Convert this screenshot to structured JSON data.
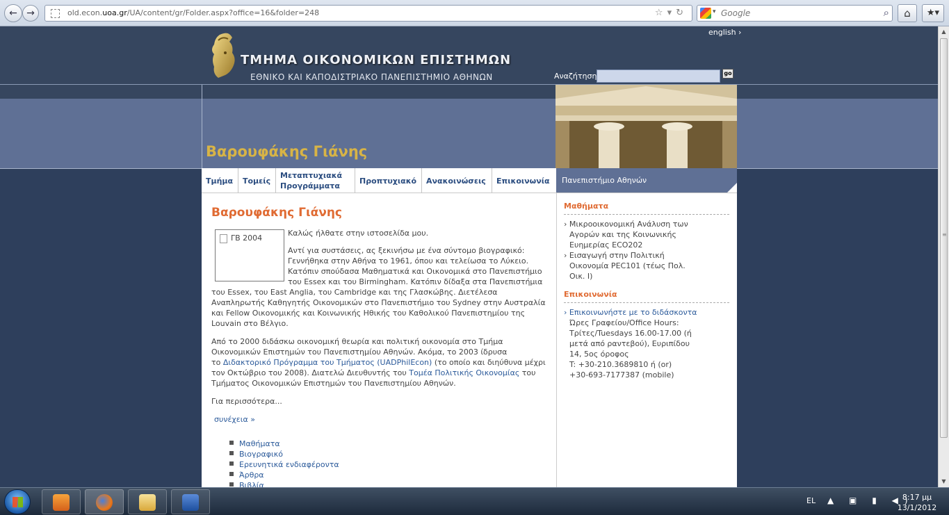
{
  "browser": {
    "url_prefix": "old.econ.",
    "url_domain": "uoa.gr",
    "url_path": "/UA/content/gr/Folder.aspx?office=16&folder=248",
    "search_placeholder": "Google",
    "back_icon": "←",
    "forward_icon": "→",
    "home_icon": "⌂",
    "bookmarks_icon": "★▾",
    "url_icons": "☆▾↻",
    "search_icon": "⌕"
  },
  "header": {
    "english_link": "english ›",
    "site_title": "ΤΜΗΜΑ ΟΙΚΟΝΟΜΙΚΩΝ ΕΠΙΣΤΗΜΩΝ",
    "site_subtitle": "ΕΘΝΙΚΟ ΚΑΙ ΚΑΠΟΔΙΣΤΡΙΑΚΟ ΠΑΝΕΠΙΣΤΗΜΙΟ ΑΘΗΝΩΝ",
    "search_label": "Αναζήτηση:",
    "search_go": "go",
    "person_title": "Βαρουφάκης Γιάνης"
  },
  "nav": {
    "items": [
      {
        "label": "Τμήμα"
      },
      {
        "label": "Τομείς"
      },
      {
        "label": "Μεταπτυχιακά Προγράμματα"
      },
      {
        "label": "Προπτυχιακό"
      },
      {
        "label": "Ανακοινώσεις"
      },
      {
        "label": "Επικοινωνία"
      }
    ],
    "sidebar_head": "Πανεπιστήμιο Αθηνών"
  },
  "main": {
    "heading": "Βαροufάκης Γιάνης",
    "image_alt": "ΓΒ 2004",
    "welcome": "Καλώς ήλθατε στην ιστοσελίδα μου.",
    "bio1_lines": [
      "Αντί για συστάσεις, ας ξεκινήσω με ένα σύντομο βιογραφικό:",
      "Γεννήθηκα στην Αθήνα το 1961, όπου και τελείωσα το Λύκειο.",
      "Κατόπιν σπούδασα Μαθηματικά και Οικονομικά στο Πανεπιστήμιο",
      "του Essex και του Birmingham. Κατόπιν δίδαξα στα Πανεπιστήμια"
    ],
    "bio1_full_lines": [
      "του Essex, του East Anglia, του Cambridge και της Γλασκώβης. Διετέλεσα",
      "Αναπληρωτής Καθηγητής Οικονομικών στο Πανεπιστήμιο του Sydney στην Αυστραλία",
      "και Fellow Οικονομικής και Κοινωνικής Ηθικής του Καθολικού Πανεπιστημίου της",
      "Louvain στο Βέλγιο."
    ],
    "bio2_line1": "Από το 2000 διδάσκω οικονομική θεωρία και πολιτική οικονομία στο Τμήμα",
    "bio2_line2": "Οικονομικών Επιστημών του Πανεπιστημίου Αθηνών. Ακόμα, το 2003 ίδρυσα",
    "bio2_line3_pre": "το ",
    "bio2_link1": "Διδακτορικό Πρόγραμμα του Τμήματος (UADPhilEcon)",
    "bio2_line3_post": " (το οποίο και διηύθυνα μέχρι",
    "bio2_line4": "τον Οκτώβριο του 2008). Διατελώ Διευθυντής του ",
    "bio2_link2": "Τομέα Πολιτικής Οικονομίας",
    "bio2_line4_post": " του",
    "bio2_line5": "Τμήματος Οικονομικών Επιστημών του Πανεπιστημίου Αθηνών.",
    "more_text": "Για περισσότερα...",
    "continue_link": "συνέχεια »",
    "bullets": [
      "Μαθήματα",
      "Βιογραφικό",
      "Ερευνητικά ενδιαφέροντα",
      "Άρθρα",
      "Βιβλία"
    ]
  },
  "sidebar": {
    "courses_heading": "Μαθήματα",
    "course1": [
      "› Μικροοικονομική Ανάλυση των",
      "Αγορών και της Κοινωνικής",
      "Ευημερίας ECO202"
    ],
    "course2": [
      "› Εισαγωγή στην Πολιτική",
      "Οικονομία PEC101 (τέως Πολ.",
      "Οικ. Ι)"
    ],
    "contact_heading": "Επικοινωνία",
    "contact_link": "› Επικοινωνήστε με το διδάσκοντα",
    "contact_lines": [
      "Ώρες Γραφείου/Office Hours:",
      "Τρίτες/Tuesdays 16.00-17.00 (ή",
      "μετά από ραντεβού), Ευριπίδου",
      "14, 5ος όροφος",
      "T: +30-210.3689810 ή (or)",
      "+30-693-7177387 (mobile)"
    ]
  },
  "taskbar": {
    "language": "EL",
    "tray_icons": "▲ ▣ ▮ ◀)",
    "time": "8:17 μμ",
    "date": "13/1/2012"
  }
}
